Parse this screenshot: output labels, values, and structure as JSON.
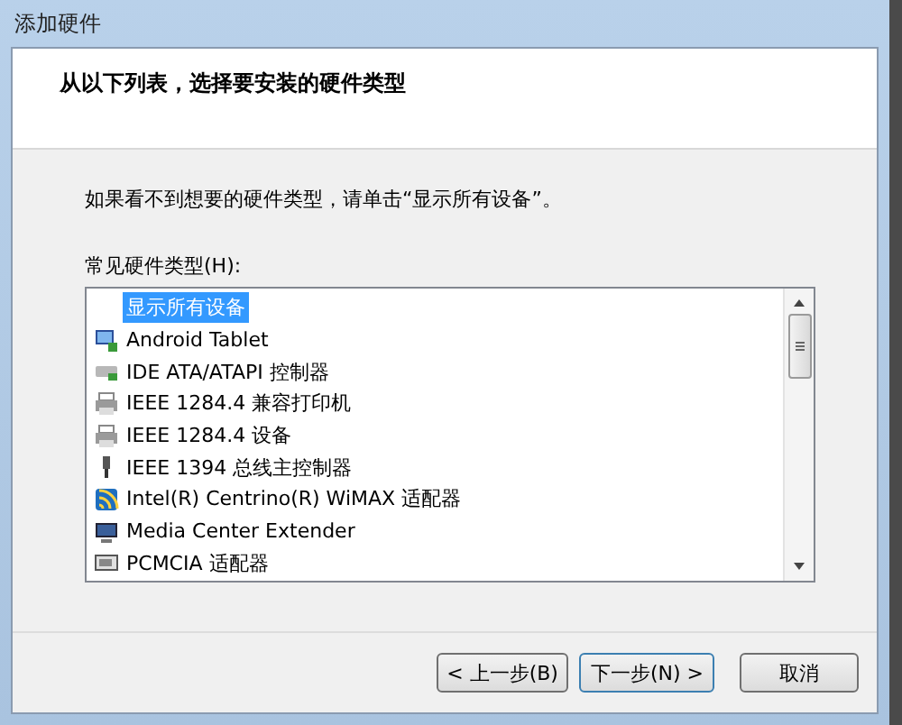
{
  "window": {
    "title": "添加硬件"
  },
  "header": {
    "heading": "从以下列表，选择要安装的硬件类型"
  },
  "instruction": "如果看不到想要的硬件类型，请单击“显示所有设备”。",
  "list": {
    "label": "常见硬件类型(H):",
    "items": [
      {
        "label": "显示所有设备",
        "selected": true
      },
      {
        "label": "Android Tablet",
        "selected": false
      },
      {
        "label": "IDE ATA/ATAPI 控制器",
        "selected": false
      },
      {
        "label": "IEEE 1284.4 兼容打印机",
        "selected": false
      },
      {
        "label": "IEEE 1284.4 设备",
        "selected": false
      },
      {
        "label": "IEEE 1394 总线主控制器",
        "selected": false
      },
      {
        "label": "Intel(R) Centrino(R) WiMAX 适配器",
        "selected": false
      },
      {
        "label": "Media Center Extender",
        "selected": false
      },
      {
        "label": "PCMCIA 适配器",
        "selected": false
      }
    ]
  },
  "buttons": [
    {
      "label": "< 上一步(B)",
      "default": false
    },
    {
      "label": "下一步(N) >",
      "default": true
    },
    {
      "label": "取消",
      "default": false
    }
  ]
}
